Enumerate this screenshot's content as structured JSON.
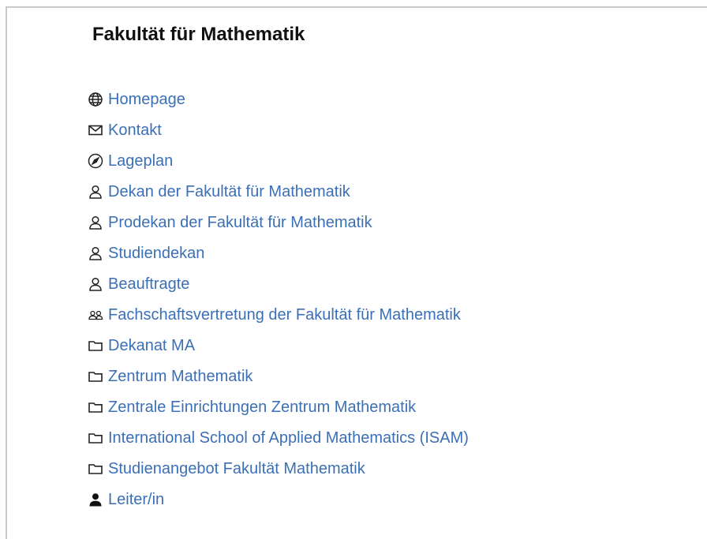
{
  "section": {
    "title": "Fakultät für Mathematik"
  },
  "links": [
    {
      "label": "Homepage",
      "icon": "globe-icon"
    },
    {
      "label": "Kontakt",
      "icon": "envelope-icon"
    },
    {
      "label": "Lageplan",
      "icon": "compass-icon"
    },
    {
      "label": "Dekan der Fakultät für Mathematik",
      "icon": "person-outline-icon"
    },
    {
      "label": "Prodekan der Fakultät für Mathematik",
      "icon": "person-outline-icon"
    },
    {
      "label": "Studiendekan",
      "icon": "person-outline-icon"
    },
    {
      "label": "Beauftragte",
      "icon": "person-outline-icon"
    },
    {
      "label": "Fachschaftsvertretung der Fakultät für Mathematik",
      "icon": "group-icon"
    },
    {
      "label": "Dekanat MA",
      "icon": "folder-icon"
    },
    {
      "label": "Zentrum Mathematik",
      "icon": "folder-icon"
    },
    {
      "label": "Zentrale Einrichtungen Zentrum Mathematik",
      "icon": "folder-icon"
    },
    {
      "label": "International School of Applied Mathematics (ISAM)",
      "icon": "folder-icon"
    },
    {
      "label": "Studienangebot Fakultät Mathematik",
      "icon": "folder-icon"
    },
    {
      "label": "Leiter/in",
      "icon": "person-filled-icon"
    }
  ],
  "colors": {
    "link": "#3b6fb6",
    "title": "#111111",
    "icon": "#222222",
    "border": "#c8c8c8"
  }
}
